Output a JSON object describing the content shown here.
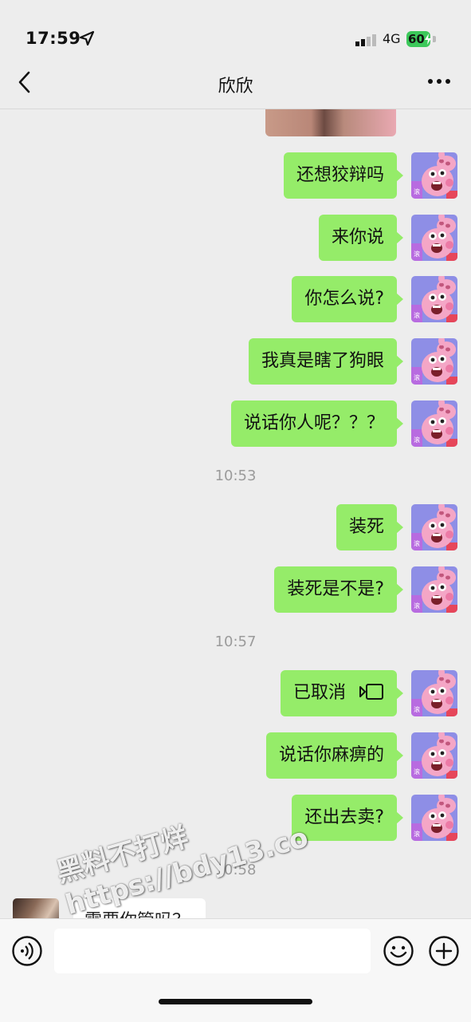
{
  "status_bar": {
    "time": "17:59",
    "network": "4G",
    "battery": "60"
  },
  "header": {
    "title": "欣欣"
  },
  "messages": [
    {
      "text": "还想狡辩吗"
    },
    {
      "text": "来你说"
    },
    {
      "text": "你怎么说?"
    },
    {
      "text": "我真是瞎了狗眼"
    },
    {
      "text": "说话你人呢？？？"
    },
    {
      "text": "装死"
    },
    {
      "text": "装死是不是?"
    },
    {
      "text": "已取消"
    },
    {
      "text": "说话你麻痹的"
    },
    {
      "text": "还出去卖?"
    }
  ],
  "timestamps": [
    "10:53",
    "10:57",
    "10:58"
  ],
  "incoming": {
    "text": "需要你管吗？"
  },
  "avatar": {
    "badge": "滚"
  },
  "watermark": {
    "line1": "黑料不打烊",
    "line2": "https://bdy13.co"
  },
  "input": {
    "value": ""
  },
  "colors": {
    "bubble_out": "#95ec69",
    "background": "#ededed",
    "battery": "#3cc85a"
  },
  "icons": [
    "location-arrow-icon",
    "signal-icon",
    "battery-icon",
    "back-icon",
    "more-icon",
    "video-call-icon",
    "voice-icon",
    "emoji-icon",
    "plus-icon"
  ]
}
